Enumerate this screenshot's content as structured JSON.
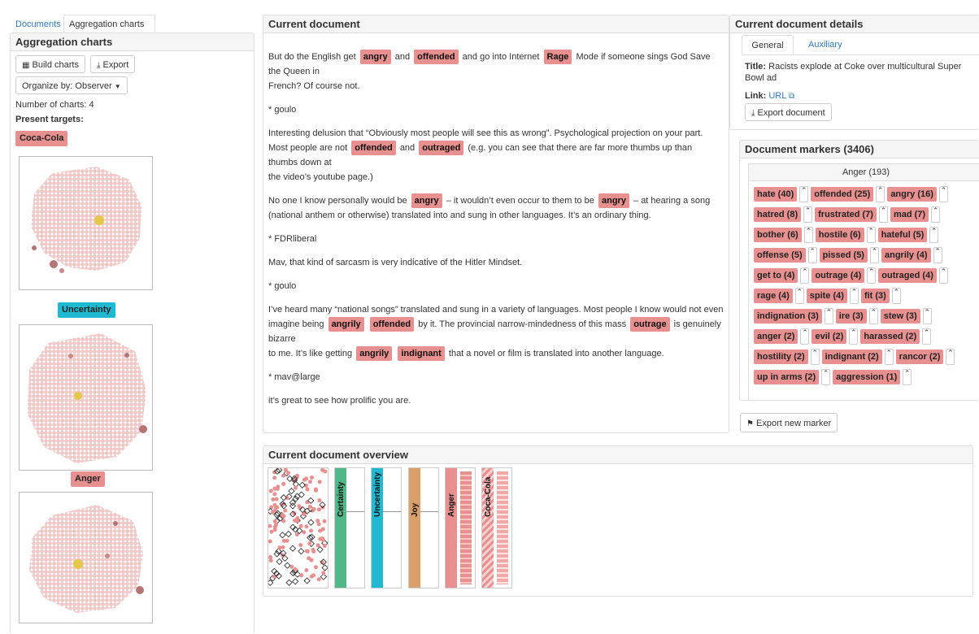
{
  "left_tabs": {
    "documents": "Documents",
    "aggregation": "Aggregation charts"
  },
  "left_panel": {
    "title": "Aggregation charts",
    "build_label": "Build charts",
    "export_label": "Export",
    "organize_label": "Organize by: Observer",
    "count_text": "Number of charts: 4",
    "targets_label": "Present targets:",
    "targets": [
      "Coca-Cola",
      "Uncertainty",
      "Anger"
    ]
  },
  "doc_panel": {
    "title": "Current document",
    "lines": {
      "l1a": "But do the English get",
      "hl1": "angry",
      "l1b": "and",
      "hl2": "offended",
      "l1c": "and go into Internet",
      "hl3": "Rage",
      "l1d": "Mode if someone sings God Save the Queen in",
      "l2": "French? Of course not.",
      "l3": "* goulo",
      "l4": "Interesting delusion that “Obviously most people will see this as wrong”. Psychological projection on your part.",
      "l5a": "Most people are not",
      "hl4": "offended",
      "l5b": "and",
      "hl5": "outraged",
      "l5c": "(e.g. you can see that there are far more thumbs up than thumbs down at",
      "l6": "the video’s youtube page.)",
      "l7a": "No one I know personally would be",
      "hl6": "angry",
      "l7b": "– it wouldn’t even occur to them to be",
      "hl7": "angry",
      "l7c": "– at hearing a song",
      "l8": "(national anthem or otherwise) translated into and sung in other languages. It’s an ordinary thing.",
      "l9": "* FDRliberal",
      "l10": "Mav, that kind of sarcasm is very indicative of the Hitler Mindset.",
      "l11": "* goulo",
      "l12": "I’ve heard many “national songs” translated and sung in a variety of languages. Most people I know would not even",
      "l13a": "imagine being",
      "hl8": "angrily",
      "hl9": "offended",
      "l13b": "by it. The provincial narrow-mindedness of this mass",
      "hl10": "outrage",
      "l13c": "is genuinely bizarre",
      "l14a": "to me. It’s like getting",
      "hl11": "angrily",
      "hl12": "indignant",
      "l14b": "that a novel or film is translated into another language.",
      "l15": "* mav@large",
      "l16": "it’s great to see how prolific you are."
    }
  },
  "details_panel": {
    "title": "Current document details",
    "tab_general": "General",
    "tab_aux": "Auxiliary",
    "title_label": "Title:",
    "title_value": "Racists explode at Coke over multicultural Super Bowl ad",
    "link_label": "Link:",
    "link_value": "URL",
    "export_doc_label": "Export document"
  },
  "markers_panel": {
    "title": "Document markers (3406)",
    "group": "Anger (193)",
    "items": [
      "hate (40)",
      "offended (25)",
      "angry (16)",
      "hatred (8)",
      "frustrated (7)",
      "mad (7)",
      "bother (6)",
      "hostile (6)",
      "hateful (5)",
      "offense (5)",
      "pissed (5)",
      "angrily (4)",
      "get to (4)",
      "outrage (4)",
      "outraged (4)",
      "rage (4)",
      "spite (4)",
      "fit (3)",
      "indignation (3)",
      "ire (3)",
      "stew (3)",
      "anger (2)",
      "evil (2)",
      "harassed (2)",
      "hostility (2)",
      "indignant (2)",
      "rancor (2)",
      "up in arms (2)",
      "aggression (1)"
    ],
    "export_marker_label": "Export new marker"
  },
  "overview_panel": {
    "title": "Current document overview",
    "columns": [
      "Certainty",
      "Uncertainty",
      "Joy",
      "Anger",
      "Coca-Cola"
    ]
  },
  "colors": {
    "anger": "#e8908f",
    "certainty": "#52b788",
    "uncertainty": "#1fb9d1",
    "joy": "#d9a06b",
    "accent": "#337ab7"
  }
}
